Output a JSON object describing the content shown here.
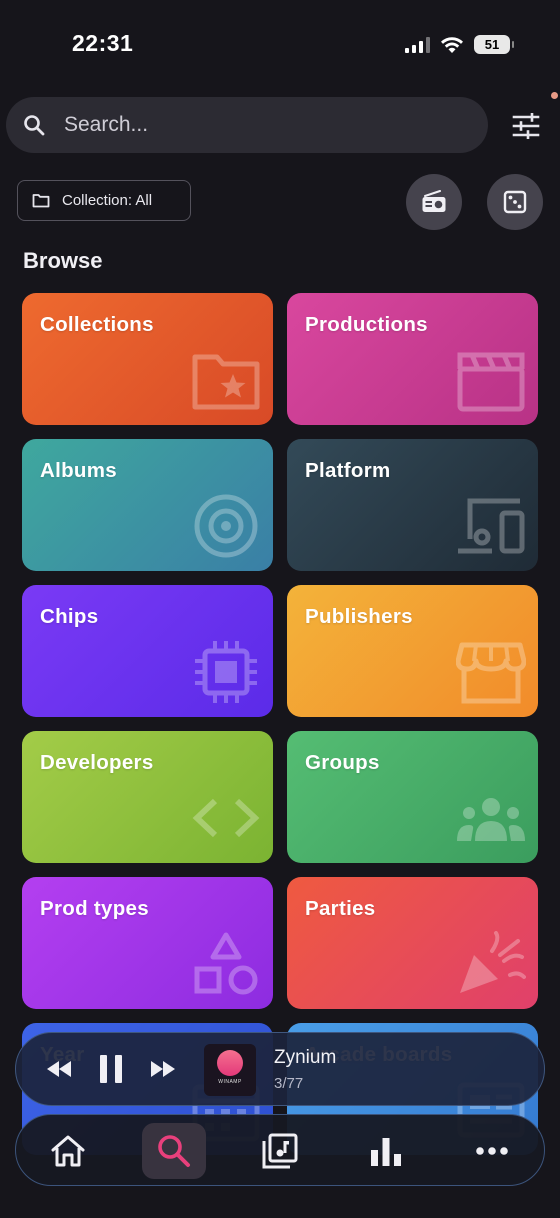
{
  "status_bar": {
    "time": "22:31",
    "battery": "51"
  },
  "search": {
    "placeholder": "Search..."
  },
  "collection_chip": {
    "label": "Collection: All"
  },
  "browse": {
    "title": "Browse",
    "tiles": [
      {
        "label": "Collections",
        "icon": "folder-star-icon",
        "color_start": "#ee6a2f",
        "color_end": "#d84a27"
      },
      {
        "label": "Productions",
        "icon": "clapperboard-icon",
        "color_start": "#d9479e",
        "color_end": "#b83286"
      },
      {
        "label": "Albums",
        "icon": "disc-icon",
        "color_start": "#3fa89e",
        "color_end": "#3a7fa6"
      },
      {
        "label": "Platform",
        "icon": "devices-icon",
        "color_start": "#334a58",
        "color_end": "#1f2b36"
      },
      {
        "label": "Chips",
        "icon": "chip-icon",
        "color_start": "#7a3af5",
        "color_end": "#5b2be8"
      },
      {
        "label": "Publishers",
        "icon": "storefront-icon",
        "color_start": "#f3b33a",
        "color_end": "#f28b2a"
      },
      {
        "label": "Developers",
        "icon": "code-icon",
        "color_start": "#a3cc48",
        "color_end": "#7bb332"
      },
      {
        "label": "Groups",
        "icon": "group-icon",
        "color_start": "#55bd73",
        "color_end": "#3b9d5e"
      },
      {
        "label": "Prod types",
        "icon": "shapes-icon",
        "color_start": "#b43ff0",
        "color_end": "#8d2ce0"
      },
      {
        "label": "Parties",
        "icon": "party-popper-icon",
        "color_start": "#ef5a40",
        "color_end": "#e0406b"
      },
      {
        "label": "Year",
        "icon": "calendar-icon",
        "color_start": "#3e64e8",
        "color_end": "#2d4fd0"
      },
      {
        "label": "Arcade boards",
        "icon": "arcade-board-icon",
        "color_start": "#4a9ee8",
        "color_end": "#3479d0"
      }
    ]
  },
  "mini_player": {
    "track_title": "Zynium",
    "track_count": "3/77",
    "album_art_text": "WINAMP"
  },
  "accent": "#e8407c"
}
